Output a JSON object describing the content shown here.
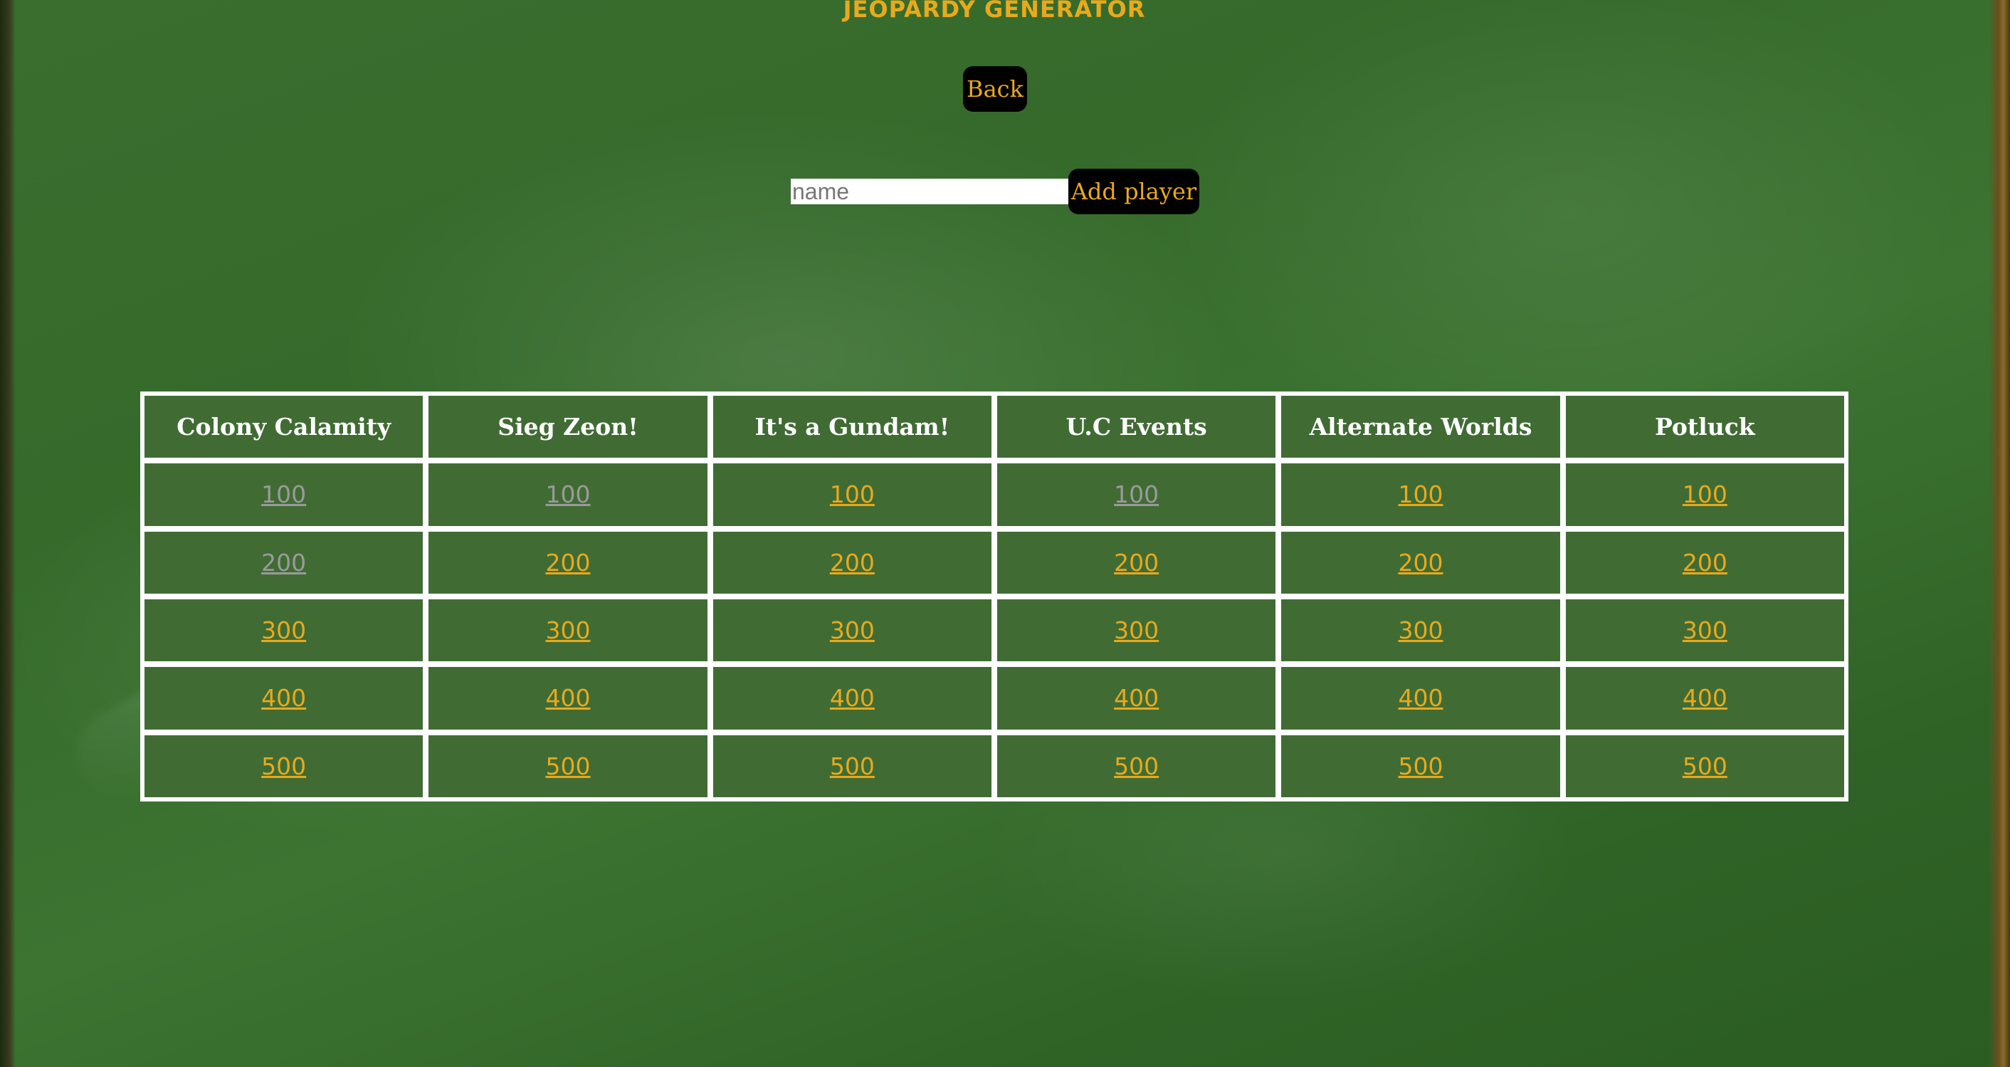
{
  "title": "JEOPARDY GENERATOR",
  "back_label": "Back",
  "player": {
    "placeholder": "name",
    "value": "",
    "add_label": "Add player"
  },
  "colors": {
    "accent": "#e8a91d",
    "used": "#9a9a9a",
    "board_bg": "#38662c",
    "button_bg": "#000000"
  },
  "board": {
    "categories": [
      "Colony Calamity",
      "Sieg Zeon!",
      "It's a Gundam!",
      "U.C Events",
      "Alternate Worlds",
      "Potluck"
    ],
    "rows": [
      [
        {
          "value": "100",
          "used": true
        },
        {
          "value": "100",
          "used": true
        },
        {
          "value": "100",
          "used": false
        },
        {
          "value": "100",
          "used": true
        },
        {
          "value": "100",
          "used": false
        },
        {
          "value": "100",
          "used": false
        }
      ],
      [
        {
          "value": "200",
          "used": true
        },
        {
          "value": "200",
          "used": false
        },
        {
          "value": "200",
          "used": false
        },
        {
          "value": "200",
          "used": false
        },
        {
          "value": "200",
          "used": false
        },
        {
          "value": "200",
          "used": false
        }
      ],
      [
        {
          "value": "300",
          "used": false
        },
        {
          "value": "300",
          "used": false
        },
        {
          "value": "300",
          "used": false
        },
        {
          "value": "300",
          "used": false
        },
        {
          "value": "300",
          "used": false
        },
        {
          "value": "300",
          "used": false
        }
      ],
      [
        {
          "value": "400",
          "used": false
        },
        {
          "value": "400",
          "used": false
        },
        {
          "value": "400",
          "used": false
        },
        {
          "value": "400",
          "used": false
        },
        {
          "value": "400",
          "used": false
        },
        {
          "value": "400",
          "used": false
        }
      ],
      [
        {
          "value": "500",
          "used": false
        },
        {
          "value": "500",
          "used": false
        },
        {
          "value": "500",
          "used": false
        },
        {
          "value": "500",
          "used": false
        },
        {
          "value": "500",
          "used": false
        },
        {
          "value": "500",
          "used": false
        }
      ]
    ]
  }
}
